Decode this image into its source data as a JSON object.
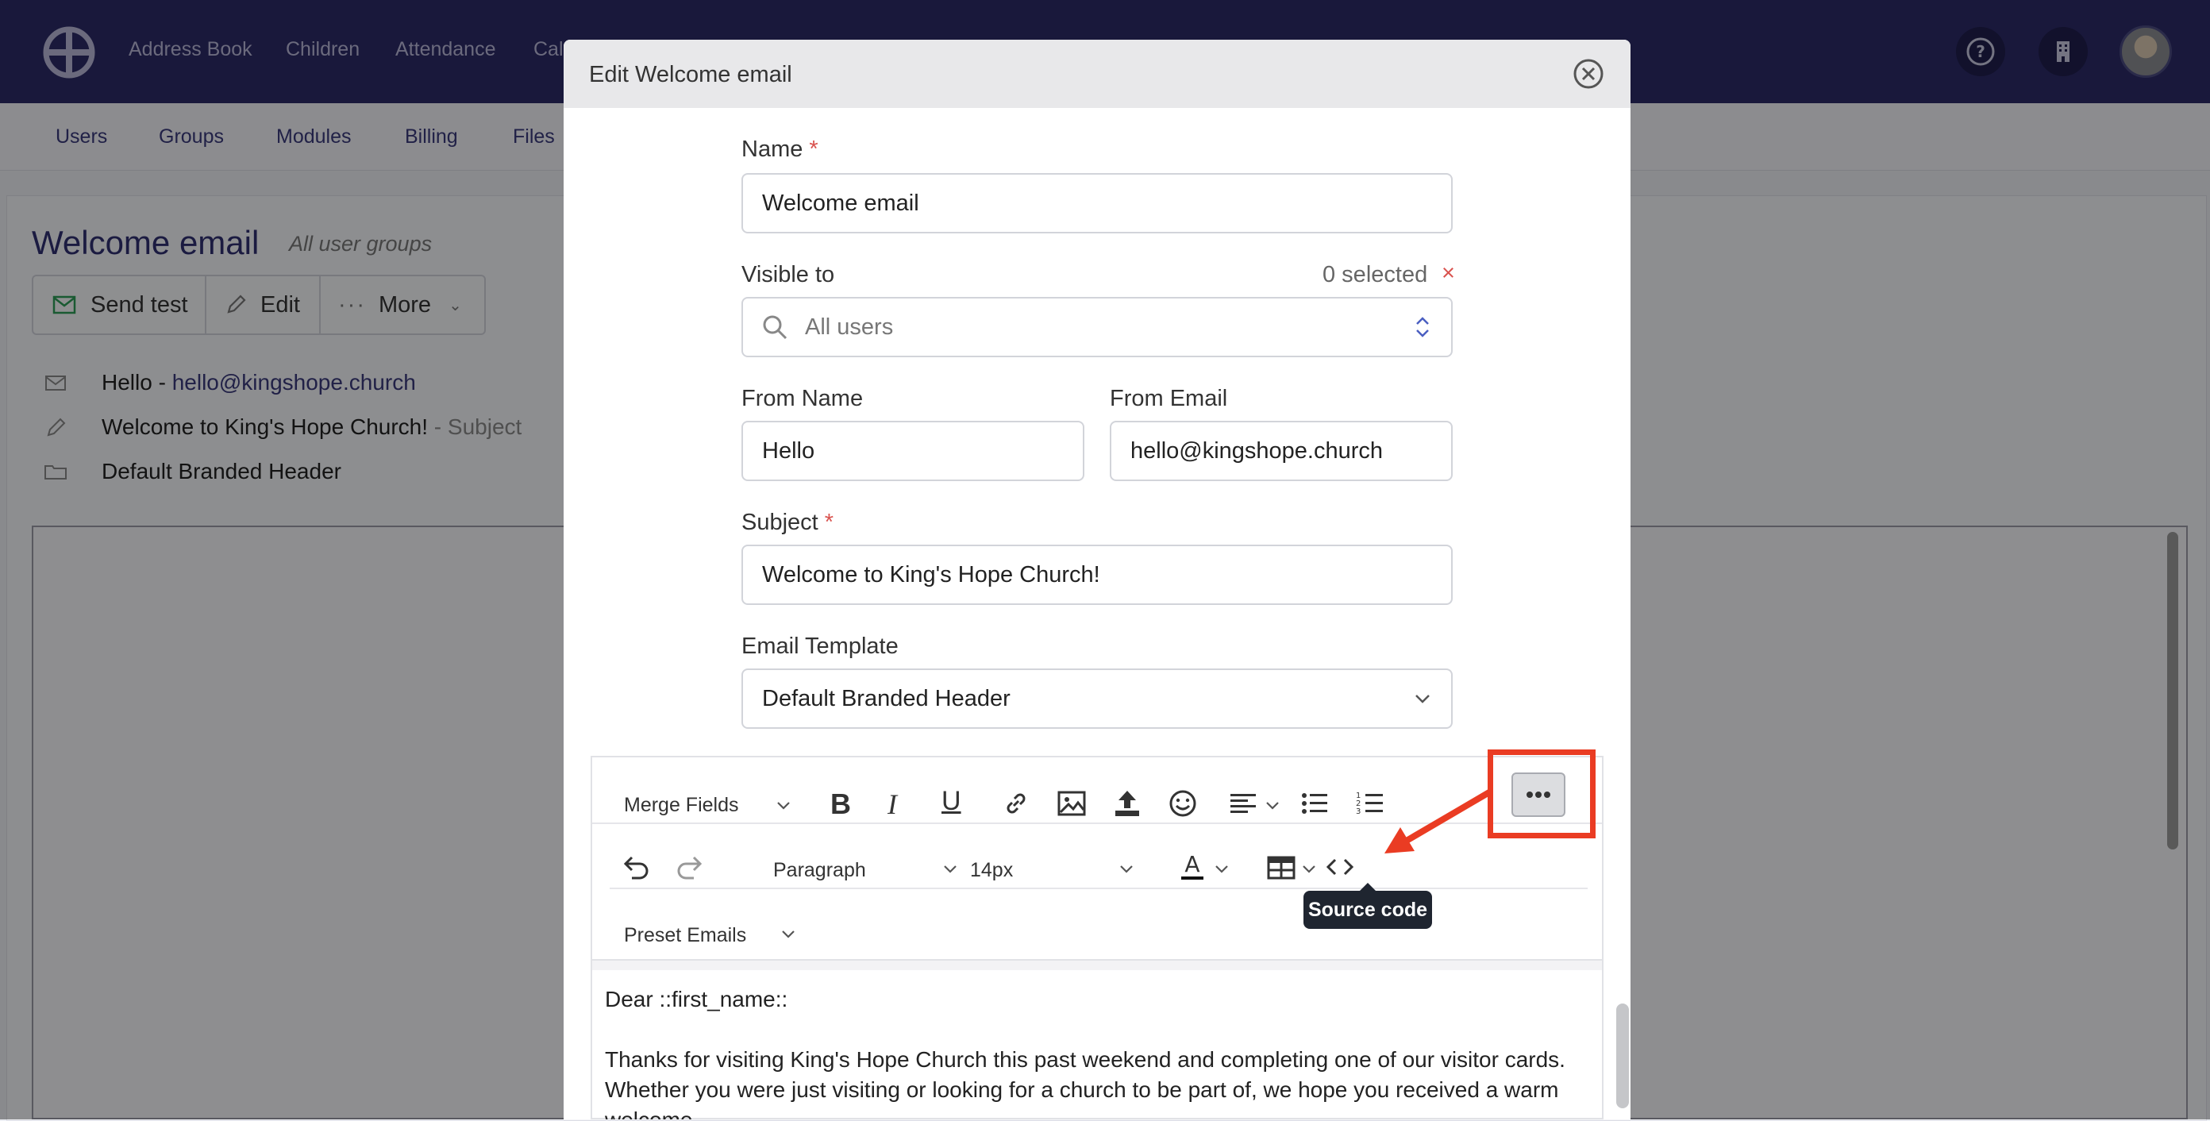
{
  "topbar": {
    "nav": [
      "Address Book",
      "Children",
      "Attendance",
      "Cal"
    ]
  },
  "subbar": {
    "tabs": [
      "Users",
      "Groups",
      "Modules",
      "Billing",
      "Files"
    ]
  },
  "page": {
    "title": "Welcome email",
    "subtitle": "All user groups",
    "buttons": {
      "send_test": "Send test",
      "edit": "Edit",
      "more": "More"
    },
    "info": {
      "from_name": "Hello - ",
      "from_email": "hello@kingshope.church",
      "subject": "Welcome to King's Hope Church!",
      "subject_suffix": " - Subject",
      "template": "Default Branded Header"
    }
  },
  "modal": {
    "title": "Edit Welcome email",
    "name_label": "Name",
    "required_mark": "*",
    "name_value": "Welcome email",
    "visible_label": "Visible to",
    "selected_count": "0 selected",
    "clear_mark": "×",
    "visible_placeholder": "All users",
    "from_name_label": "From Name",
    "from_name_value": "Hello",
    "from_email_label": "From Email",
    "from_email_value": "hello@kingshope.church",
    "subject_label": "Subject",
    "subject_value": "Welcome to King's Hope Church!",
    "template_label": "Email Template",
    "template_value": "Default Branded Header"
  },
  "editor": {
    "merge_fields": "Merge Fields",
    "block_format": "Paragraph",
    "font_size": "14px",
    "preset_emails": "Preset Emails",
    "tooltip": "Source code",
    "content": {
      "line1": "Dear ::first_name::",
      "para": "Thanks for visiting King's Hope Church this past weekend and completing one of our visitor cards. Whether you were just visiting or looking for a church to be part of, we hope you received a warm welcome."
    }
  },
  "annotation": {
    "color": "#ea3c23"
  }
}
